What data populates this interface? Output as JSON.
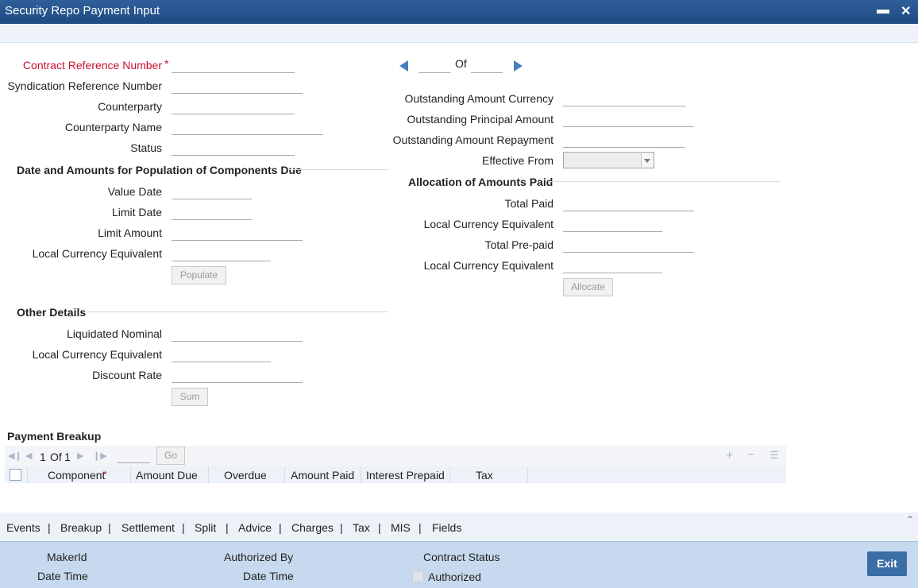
{
  "window": {
    "title": "Security Repo Payment Input",
    "minimize": "▬",
    "close": "✕"
  },
  "contract": {
    "contract_ref_label": "Contract Reference Number",
    "required_mark": "*",
    "syndication_ref_label": "Syndication Reference Number",
    "counterparty_label": "Counterparty",
    "counterparty_name_label": "Counterparty Name",
    "status_label": "Status"
  },
  "pager": {
    "of_label": "Of"
  },
  "outstanding": {
    "currency_label": "Outstanding Amount Currency",
    "principal_label": "Outstanding Principal Amount",
    "repayment_label": "Outstanding Amount Repayment",
    "effective_from_label": "Effective From"
  },
  "components_due": {
    "heading": "Date and Amounts for Population of Components Due",
    "value_date_label": "Value Date",
    "limit_date_label": "Limit Date",
    "limit_amount_label": "Limit Amount",
    "lce_label": "Local Currency Equivalent",
    "populate_button": "Populate"
  },
  "allocation": {
    "heading": "Allocation of Amounts Paid",
    "total_paid_label": "Total Paid",
    "lce_label_1": "Local Currency Equivalent",
    "total_prepaid_label": "Total Pre-paid",
    "lce_label_2": "Local Currency Equivalent",
    "allocate_button": "Allocate"
  },
  "other_details": {
    "heading": "Other Details",
    "liquidated_nominal_label": "Liquidated Nominal",
    "lce_label": "Local Currency Equivalent",
    "discount_rate_label": "Discount Rate",
    "sum_button": "Sum"
  },
  "payment_breakup": {
    "heading": "Payment Breakup",
    "page_current": "1",
    "page_of": "Of",
    "page_total": "1",
    "go_button": "Go",
    "columns": [
      "Component",
      "Amount Due",
      "Overdue",
      "Amount Paid",
      "Interest Prepaid",
      "Tax"
    ],
    "component_required": "*"
  },
  "tabs": [
    "Events",
    "Breakup",
    "Settlement",
    "Split",
    "Advice",
    "Charges",
    "Tax",
    "MIS",
    "Fields"
  ],
  "footer": {
    "maker_id_label": "MakerId",
    "date_time_label_1": "Date Time",
    "authorized_by_label": "Authorized By",
    "date_time_label_2": "Date Time",
    "contract_status_label": "Contract Status",
    "authorized_label": "Authorized",
    "exit_button": "Exit"
  },
  "colors": {
    "title_bar": "#1f4a82",
    "required": "#c8102e",
    "footer": "#c7d9ee",
    "exit": "#3a6ea5"
  }
}
